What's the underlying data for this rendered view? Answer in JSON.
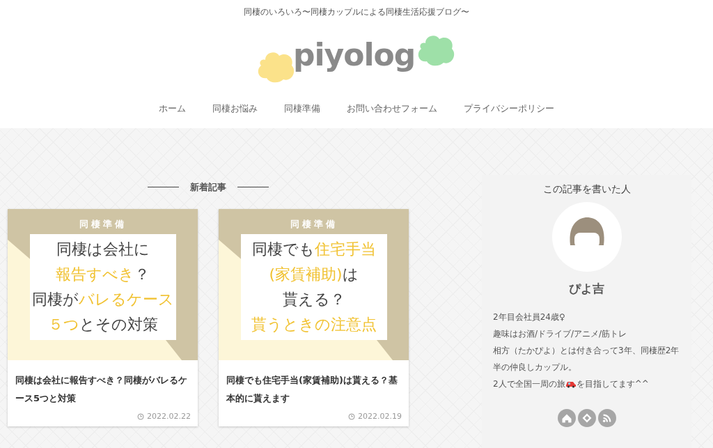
{
  "header": {
    "tagline": "同棲のいろいろ〜同棲カップルによる同棲生活応援ブログ〜",
    "logo": "piyolog"
  },
  "nav": [
    "ホーム",
    "同棲お悩み",
    "同棲準備",
    "お問い合わせフォーム",
    "プライバシーポリシー"
  ],
  "section_title": "新着記事",
  "articles": [
    {
      "category": "同棲準備",
      "thumbnail_lines": [
        [
          {
            "text": "同棲は会社に",
            "accent": false
          }
        ],
        [
          {
            "text": "報告すべき",
            "accent": true
          },
          {
            "text": "？",
            "accent": false
          }
        ],
        [
          {
            "text": "同棲が",
            "accent": false
          },
          {
            "text": "バレるケース",
            "accent": true
          }
        ],
        [
          {
            "text": "５つ",
            "accent": true
          },
          {
            "text": "とその対策",
            "accent": false
          }
        ]
      ],
      "title": "同棲は会社に報告すべき？同棲がバレるケース5つと対策",
      "date": "2022.02.22"
    },
    {
      "category": "同棲準備",
      "thumbnail_lines": [
        [
          {
            "text": "同棲でも",
            "accent": false
          },
          {
            "text": "住宅手当",
            "accent": true
          }
        ],
        [
          {
            "text": "(家賃補助)",
            "accent": true
          },
          {
            "text": "は",
            "accent": false
          }
        ],
        [
          {
            "text": "貰える？",
            "accent": false
          }
        ],
        [
          {
            "text": "貰うときの注意点",
            "accent": true
          }
        ]
      ],
      "title": "同棲でも住宅手当(家賃補助)は貰える？基本的に貰えます",
      "date": "2022.02.19"
    }
  ],
  "author": {
    "heading": "この記事を書いた人",
    "name": "ぴよ吉",
    "bio": [
      {
        "text": "2年目会社員24歳♀"
      },
      {
        "text": "趣味はお酒/ドライブ/アニメ/筋トレ"
      },
      {
        "text": "相方（たかぴよ）とは付き合って3年、同棲歴2年半の仲良しカップル。"
      },
      {
        "text": "2人で全国一周の旅",
        "kind": "with_car",
        "after": "を目指してます^^"
      }
    ],
    "links": [
      {
        "kind": "home"
      },
      {
        "kind": "feedly"
      },
      {
        "kind": "rss"
      }
    ]
  }
}
